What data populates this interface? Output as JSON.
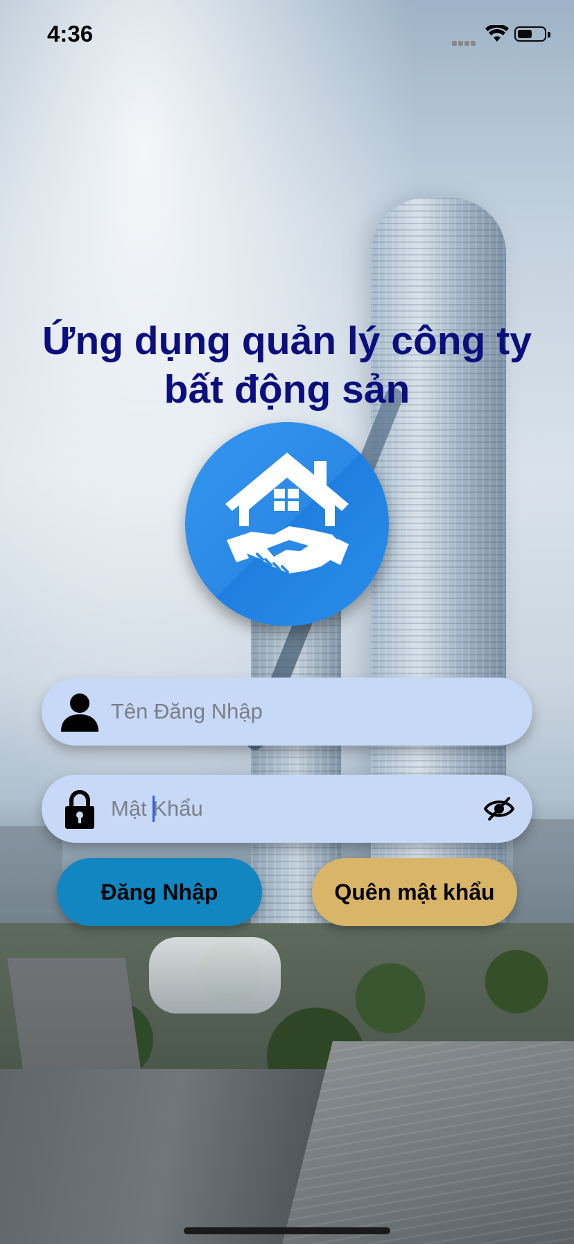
{
  "status_bar": {
    "time": "4:36",
    "signal_icon": "cellular-signal-dots",
    "wifi_icon": "wifi-icon",
    "battery_icon": "battery-icon",
    "battery_level": 0.55
  },
  "app": {
    "title": "Ứng dụng quản lý công ty bất động sản",
    "logo_icon": "house-handshake-logo",
    "logo_color": "#2b89e6"
  },
  "login_form": {
    "username": {
      "placeholder": "Tên Đăng Nhập",
      "value": "",
      "icon": "person-icon"
    },
    "password": {
      "placeholder": "Mật Khẩu",
      "value": "",
      "icon": "lock-icon",
      "toggle_icon": "eye-slash-icon",
      "focused": true
    },
    "login_button_label": "Đăng Nhập",
    "forgot_button_label": "Quên mật khẩu"
  },
  "colors": {
    "title": "#0b0f7d",
    "field_background": "#c7d9f6",
    "login_button": "#1286c0",
    "forgot_button": "#d9b56a",
    "caret": "#2c5ee8"
  }
}
